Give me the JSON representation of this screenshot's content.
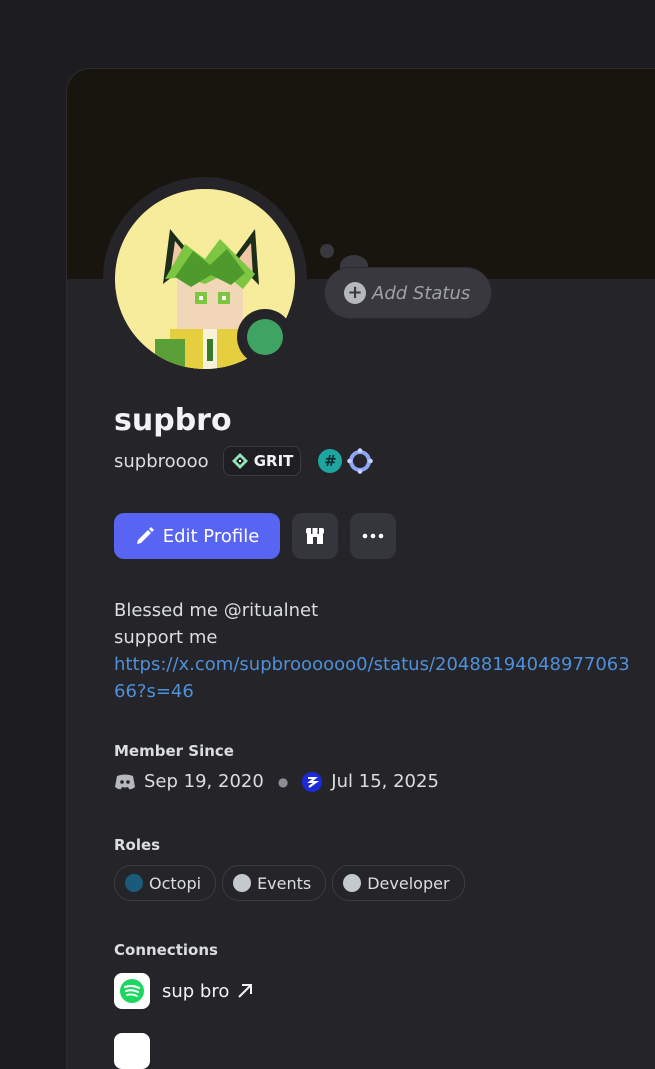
{
  "profile": {
    "display_name": "supbro",
    "username": "supbroooo",
    "guild_tag": "GRIT",
    "add_status_label": "Add Status",
    "status_color": "#3fa364",
    "icons": {
      "guild_tag": "diamond-icon",
      "badge_1": "hashtag-badge-icon",
      "badge_2": "gear-badge-icon"
    }
  },
  "actions": {
    "edit_profile_label": "Edit Profile",
    "shop_icon": "shop-icon",
    "more_icon": "more-icon",
    "accent": "#5865f2"
  },
  "bio": {
    "line1": "Blessed me @ritualnet",
    "line2": "support  me",
    "link": "https://x.com/supbroooooo0/status/2048819404897706366?s=46"
  },
  "member_since": {
    "label": "Member Since",
    "discord_date": "Sep 19, 2020",
    "server_date": "Jul 15, 2025"
  },
  "roles": {
    "label": "Roles",
    "items": [
      {
        "name": "Octopi",
        "color": "#1a5a7a"
      },
      {
        "name": "Events",
        "color": "#c4c9ce"
      },
      {
        "name": "Developer",
        "color": "#c4c9ce"
      }
    ]
  },
  "connections": {
    "label": "Connections",
    "items": [
      {
        "name": "sup bro",
        "service": "spotify-icon"
      }
    ]
  }
}
